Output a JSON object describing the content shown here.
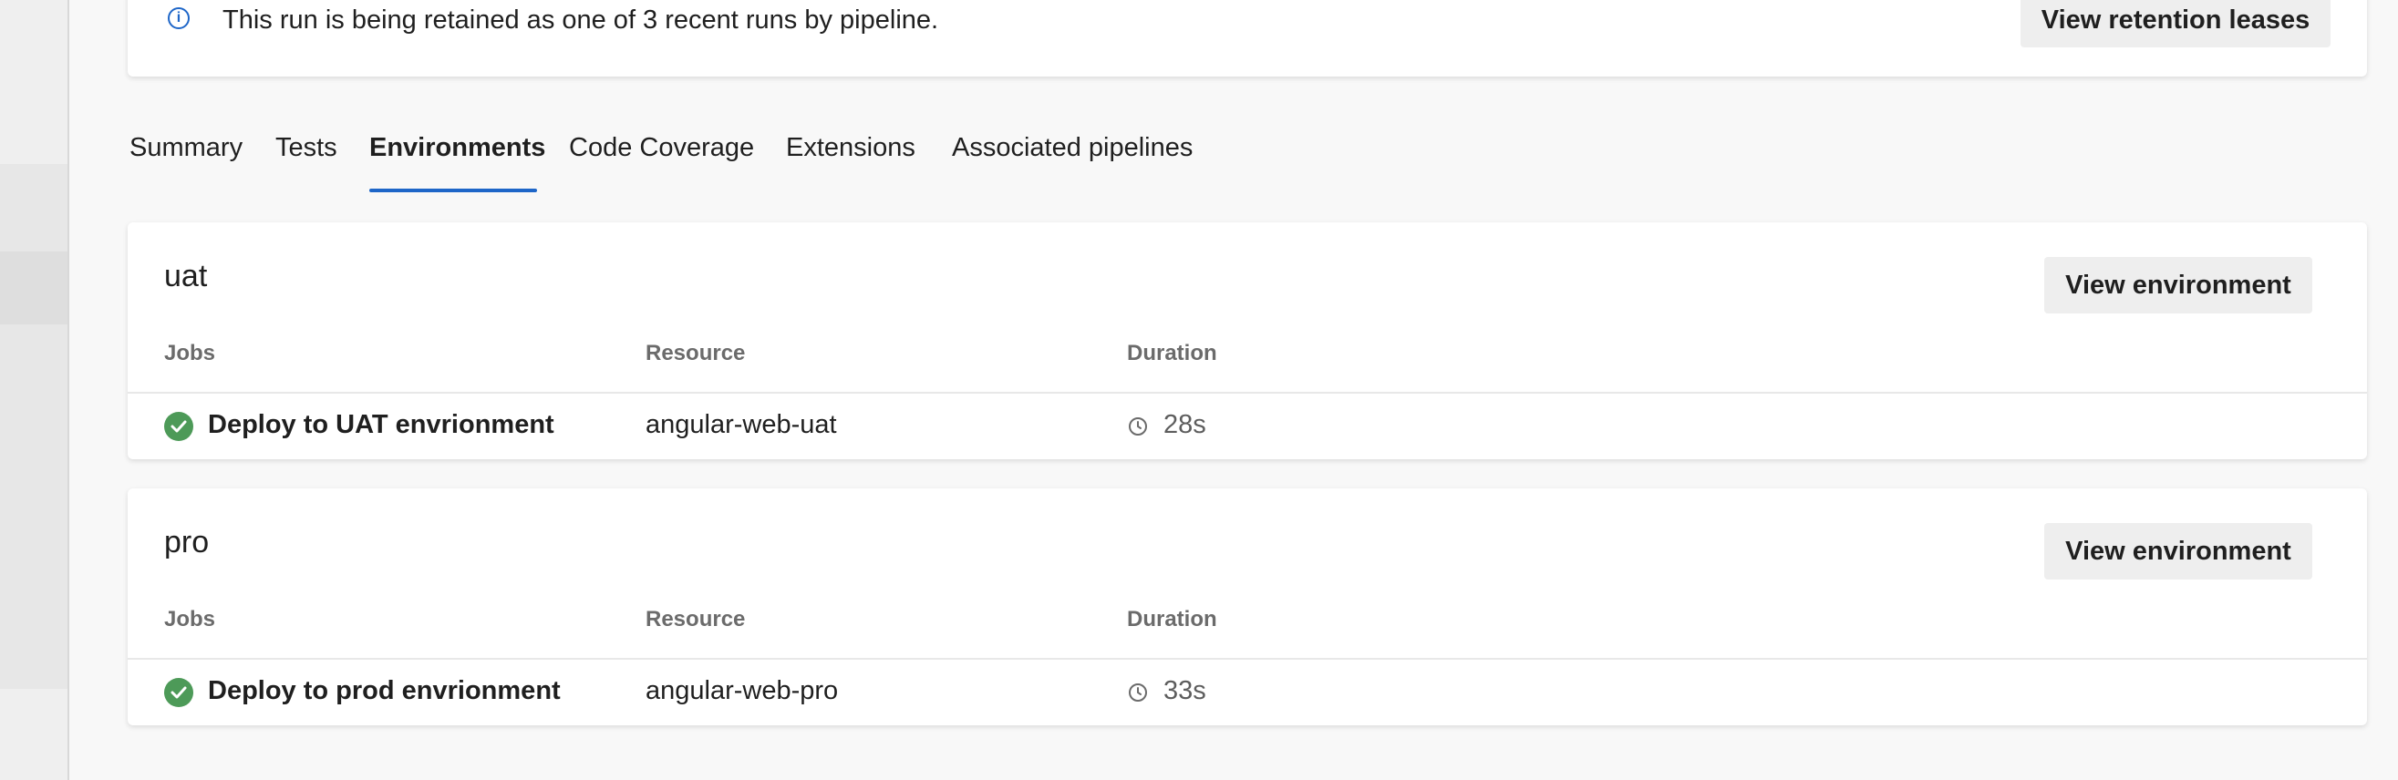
{
  "banner": {
    "text": "This run is being retained as one of 3 recent runs by pipeline.",
    "button_label": "View retention leases",
    "icon": "info-icon"
  },
  "tabs": [
    {
      "label": "Summary",
      "active": false
    },
    {
      "label": "Tests",
      "active": false
    },
    {
      "label": "Environments",
      "active": true
    },
    {
      "label": "Code Coverage",
      "active": false
    },
    {
      "label": "Extensions",
      "active": false
    },
    {
      "label": "Associated pipelines",
      "active": false
    }
  ],
  "accent_color": "#1e66c8",
  "success_color": "#4d9a58",
  "columns": {
    "jobs": "Jobs",
    "resource": "Resource",
    "duration": "Duration"
  },
  "environments": [
    {
      "name": "uat",
      "button_label": "View environment",
      "job": {
        "name": "Deploy to UAT envrionment",
        "status": "success",
        "resource": "angular-web-uat",
        "duration": "28s"
      }
    },
    {
      "name": "pro",
      "button_label": "View environment",
      "job": {
        "name": "Deploy to prod envrionment",
        "status": "success",
        "resource": "angular-web-pro",
        "duration": "33s"
      }
    }
  ]
}
